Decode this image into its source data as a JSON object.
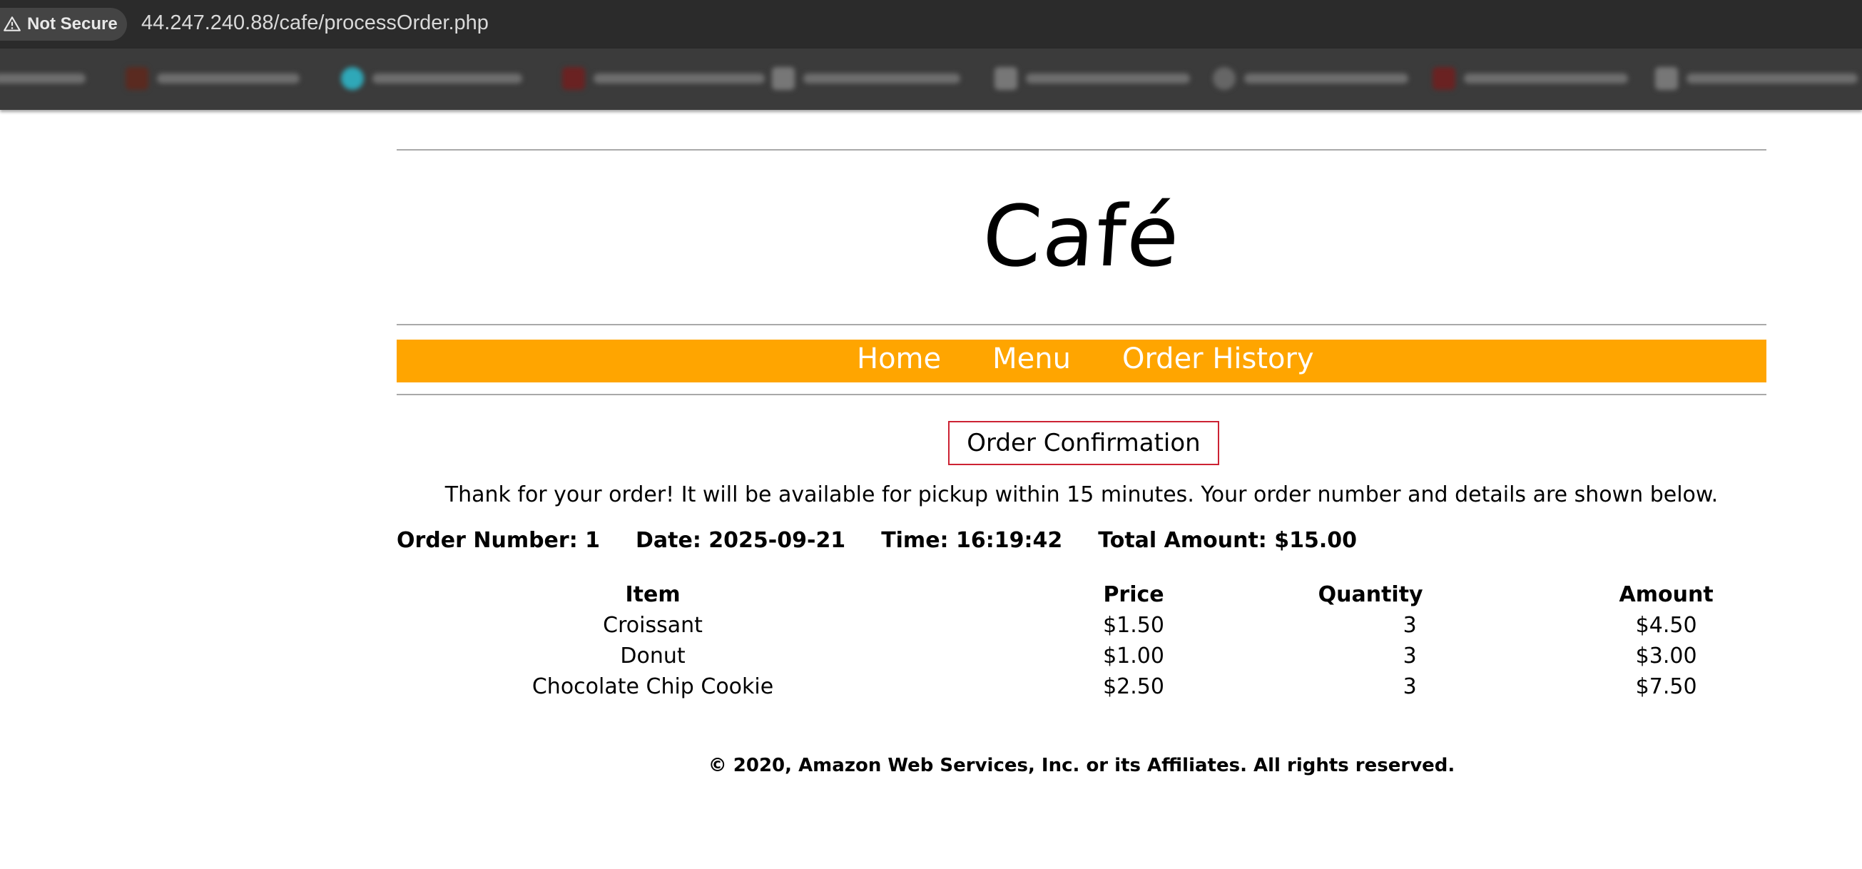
{
  "browser": {
    "security_label": "Not Secure",
    "url": "44.247.240.88/cafe/processOrder.php"
  },
  "site": {
    "title": "Café",
    "nav": [
      "Home",
      "Menu",
      "Order History"
    ]
  },
  "order": {
    "heading": "Order Confirmation",
    "message": "Thank for your order! It will be available for pickup within 15 minutes. Your order number and details are shown below.",
    "summary": {
      "order_number": "Order Number: 1",
      "date": "Date: 2025-09-21",
      "time": "Time: 16:19:42",
      "total": "Total Amount: $15.00"
    },
    "table": {
      "headers": [
        "Item",
        "Price",
        "Quantity",
        "Amount"
      ],
      "rows": [
        [
          "Croissant",
          "$1.50",
          "3",
          "$4.50"
        ],
        [
          "Donut",
          "$1.00",
          "3",
          "$3.00"
        ],
        [
          "Chocolate Chip Cookie",
          "$2.50",
          "3",
          "$7.50"
        ]
      ]
    }
  },
  "footer": "© 2020, Amazon Web Services, Inc. or its Affiliates. All rights reserved.",
  "colors": {
    "nav_background": "#ffa500",
    "confirm_border": "#cc2233",
    "chrome_dark": "#2b2b2b"
  }
}
